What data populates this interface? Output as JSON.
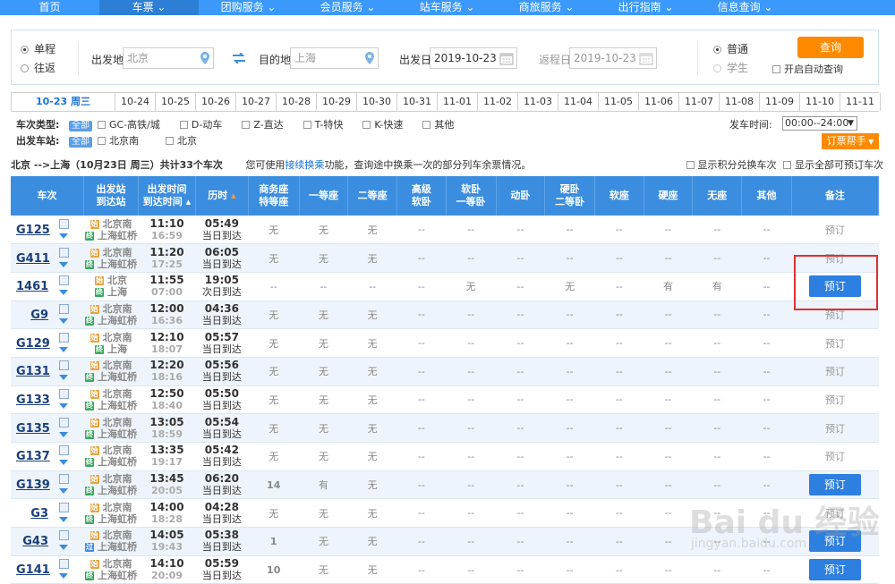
{
  "nav": [
    "首页",
    "车票",
    "团购服务",
    "会员服务",
    "站车服务",
    "商旅服务",
    "出行指南",
    "信息查询"
  ],
  "query": {
    "one_way": "单程",
    "round_trip": "往返",
    "from_label": "出发地",
    "from_value": "北京",
    "to_label": "目的地",
    "to_value": "上海",
    "depart_label": "出发日",
    "depart_value": "2019-10-23",
    "return_label": "返程日",
    "return_value": "2019-10-23",
    "normal": "普通",
    "student": "学生",
    "query_button": "查询",
    "auto_query": "开启自动查询"
  },
  "dates": [
    "10-23 周三",
    "10-24",
    "10-25",
    "10-26",
    "10-27",
    "10-28",
    "10-29",
    "10-30",
    "10-31",
    "11-01",
    "11-02",
    "11-03",
    "11-04",
    "11-05",
    "11-06",
    "11-07",
    "11-08",
    "11-09",
    "11-10",
    "11-11"
  ],
  "filters": {
    "type_label": "车次类型:",
    "all": "全部",
    "types": [
      "GC-高铁/城",
      "D-动车",
      "Z-直达",
      "T-特快",
      "K-快速",
      "其他"
    ],
    "station_label": "出发车站:",
    "stations": [
      "北京南",
      "北京"
    ],
    "time_label": "发车时间:",
    "time_value": "00:00--24:00",
    "helper": "订票帮手"
  },
  "route": {
    "summary": "北京 -->上海（10月23日 周三）共计33个车次",
    "tip_pre": "您可使用",
    "tip_link": "接续换乘",
    "tip_post": "功能，查询途中换乘一次的部分列车余票情况。",
    "opt1": "显示积分兑换车次",
    "opt2": "显示全部可预订车次"
  },
  "headers": [
    "车次",
    "出发站\n到达站",
    "出发时间\n到达时间",
    "历时",
    "商务座\n特等座",
    "一等座",
    "二等座",
    "高级\n软卧",
    "软卧\n一等卧",
    "动卧",
    "硬卧\n二等卧",
    "软座",
    "硬座",
    "无座",
    "其他",
    "备注"
  ],
  "trains": [
    {
      "no": "G125",
      "from": "北京南",
      "to": "上海虹桥",
      "dep": "11:10",
      "arr": "16:59",
      "dur": "05:49",
      "day": "当日到达",
      "seats": [
        "无",
        "无",
        "无",
        "--",
        "--",
        "--",
        "--",
        "--",
        "--",
        "--",
        "--"
      ],
      "book": "预订",
      "bookable": false
    },
    {
      "no": "G411",
      "from": "北京南",
      "to": "上海虹桥",
      "dep": "11:20",
      "arr": "17:25",
      "dur": "06:05",
      "day": "当日到达",
      "seats": [
        "无",
        "无",
        "无",
        "--",
        "--",
        "--",
        "--",
        "--",
        "--",
        "--",
        "--"
      ],
      "book": "预订",
      "bookable": false
    },
    {
      "no": "1461",
      "from": "北京",
      "to": "上海",
      "dep": "11:55",
      "arr": "07:00",
      "dur": "19:05",
      "day": "次日到达",
      "seats": [
        "--",
        "--",
        "--",
        "--",
        "无",
        "--",
        "无",
        "--",
        "有",
        "有",
        "--"
      ],
      "book": "预订",
      "bookable": true
    },
    {
      "no": "G9",
      "from": "北京南",
      "to": "上海虹桥",
      "dep": "12:00",
      "arr": "16:36",
      "dur": "04:36",
      "day": "当日到达",
      "seats": [
        "无",
        "无",
        "无",
        "--",
        "--",
        "--",
        "--",
        "--",
        "--",
        "--",
        "--"
      ],
      "book": "预订",
      "bookable": false
    },
    {
      "no": "G129",
      "from": "北京南",
      "to": "上海",
      "dep": "12:10",
      "arr": "18:07",
      "dur": "05:57",
      "day": "当日到达",
      "seats": [
        "无",
        "无",
        "无",
        "--",
        "--",
        "--",
        "--",
        "--",
        "--",
        "--",
        "--"
      ],
      "book": "预订",
      "bookable": false
    },
    {
      "no": "G131",
      "from": "北京南",
      "to": "上海虹桥",
      "dep": "12:20",
      "arr": "18:16",
      "dur": "05:56",
      "day": "当日到达",
      "seats": [
        "无",
        "无",
        "无",
        "--",
        "--",
        "--",
        "--",
        "--",
        "--",
        "--",
        "--"
      ],
      "book": "预订",
      "bookable": false
    },
    {
      "no": "G133",
      "from": "北京南",
      "to": "上海虹桥",
      "dep": "12:50",
      "arr": "18:40",
      "dur": "05:50",
      "day": "当日到达",
      "seats": [
        "无",
        "无",
        "无",
        "--",
        "--",
        "--",
        "--",
        "--",
        "--",
        "--",
        "--"
      ],
      "book": "预订",
      "bookable": false
    },
    {
      "no": "G135",
      "from": "北京南",
      "to": "上海虹桥",
      "dep": "13:05",
      "arr": "18:59",
      "dur": "05:54",
      "day": "当日到达",
      "seats": [
        "无",
        "无",
        "无",
        "--",
        "--",
        "--",
        "--",
        "--",
        "--",
        "--",
        "--"
      ],
      "book": "预订",
      "bookable": false
    },
    {
      "no": "G137",
      "from": "北京南",
      "to": "上海虹桥",
      "dep": "13:35",
      "arr": "19:17",
      "dur": "05:42",
      "day": "当日到达",
      "seats": [
        "无",
        "无",
        "无",
        "--",
        "--",
        "--",
        "--",
        "--",
        "--",
        "--",
        "--"
      ],
      "book": "预订",
      "bookable": false
    },
    {
      "no": "G139",
      "from": "北京南",
      "to": "上海虹桥",
      "dep": "13:45",
      "arr": "20:05",
      "dur": "06:20",
      "day": "当日到达",
      "seats": [
        "14",
        "有",
        "无",
        "--",
        "--",
        "--",
        "--",
        "--",
        "--",
        "--",
        "--"
      ],
      "book": "预订",
      "bookable": true
    },
    {
      "no": "G3",
      "from": "北京南",
      "to": "上海虹桥",
      "dep": "14:00",
      "arr": "18:28",
      "dur": "04:28",
      "day": "当日到达",
      "seats": [
        "无",
        "无",
        "无",
        "--",
        "--",
        "--",
        "--",
        "--",
        "--",
        "--",
        "--"
      ],
      "book": "预订",
      "bookable": false
    },
    {
      "no": "G43",
      "from": "北京南",
      "to": "上海虹桥",
      "dep": "14:05",
      "arr": "19:43",
      "dur": "05:38",
      "day": "当日到达",
      "seats": [
        "1",
        "无",
        "无",
        "--",
        "--",
        "--",
        "--",
        "--",
        "--",
        "--",
        "--"
      ],
      "book": "预订",
      "bookable": true
    },
    {
      "no": "G141",
      "from": "北京南",
      "to": "上海虹桥",
      "dep": "14:10",
      "arr": "20:09",
      "dur": "05:59",
      "day": "当日到达",
      "seats": [
        "10",
        "无",
        "无",
        "--",
        "--",
        "--",
        "--",
        "--",
        "--",
        "--",
        "--"
      ],
      "book": "预订",
      "bookable": true
    }
  ],
  "watermark": {
    "main": "Bai du 经验",
    "sub": "jingyan.baidu.com"
  }
}
